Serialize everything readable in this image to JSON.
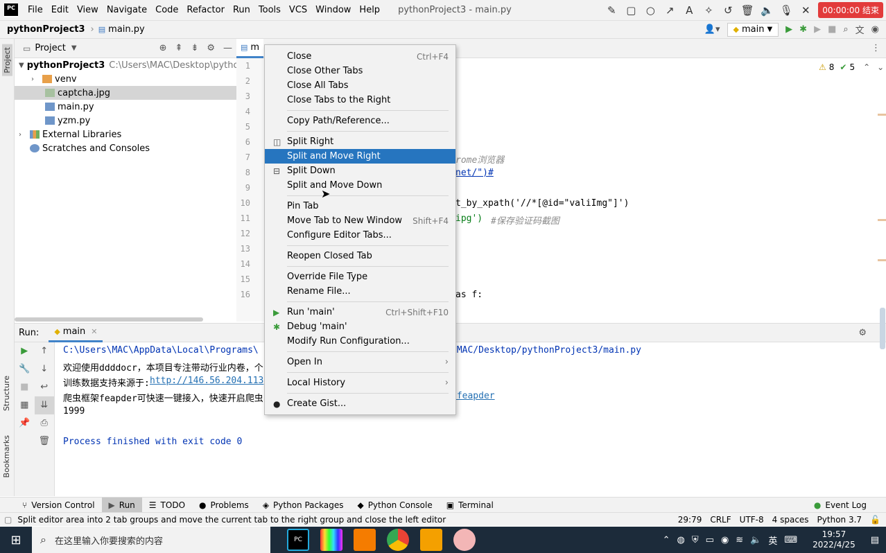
{
  "menubar": {
    "logo": "PC",
    "items": [
      "File",
      "Edit",
      "View",
      "Navigate",
      "Code",
      "Refactor",
      "Run",
      "Tools",
      "VCS",
      "Window",
      "Help"
    ],
    "title": "pythonProject3 - main.py",
    "recorder": "00:00:00 结束"
  },
  "navbar": {
    "project": "pythonProject3",
    "file": "main.py",
    "run_config": "main"
  },
  "project_panel": {
    "title": "Project",
    "tree": [
      {
        "label": "pythonProject3",
        "extra": "C:\\Users\\MAC\\Desktop\\pytho"
      },
      {
        "label": "venv"
      },
      {
        "label": "captcha.jpg"
      },
      {
        "label": "main.py"
      },
      {
        "label": "yzm.py"
      },
      {
        "label": "External Libraries"
      },
      {
        "label": "Scratches and Consoles"
      }
    ]
  },
  "editor": {
    "tab": "m",
    "inspections": {
      "warnings": "8",
      "ok": "5"
    },
    "line_numbers": [
      "1",
      "2",
      "3",
      "4",
      "5",
      "6",
      "7",
      "8",
      "9",
      "10",
      "11",
      "12",
      "13",
      "14",
      "15",
      "16"
    ],
    "code": {
      "l7": "rome浏览器",
      "l8": "net/\")#",
      "l10": "t_by_xpath('//*[@id=\"valiImg\"]')",
      "l11a": "ipg')  ",
      "l11b": "#保存验证码截图",
      "l16": "as f:"
    }
  },
  "run_panel": {
    "label": "Run:",
    "tab": "main",
    "lines": {
      "l1a": "C:\\Users\\MAC\\AppData\\Local\\Programs\\",
      "l1b": "/MAC/Desktop/pythonProject3/main.py",
      "l2": "欢迎使用ddddocr，本项目专注带动行业内卷，个",
      "l3a": "训练数据支持来源于:",
      "l3b": "http://146.56.204.113",
      "l4a": "爬虫框架feapder可快速一键接入，快速开启爬虫",
      "l4b": "/feapder",
      "l5": "1999",
      "l6": "Process finished with exit code 0"
    }
  },
  "left_strip": {
    "project": "Project",
    "structure": "Structure",
    "bookmarks": "Bookmarks"
  },
  "toolwindows": [
    "Version Control",
    "Run",
    "TODO",
    "Problems",
    "Python Packages",
    "Python Console",
    "Terminal"
  ],
  "event_log": "Event Log",
  "status": {
    "message": "Split editor area into 2 tab groups and move the current tab to the right group and close the left editor",
    "position": "29:79",
    "line_sep": "CRLF",
    "encoding": "UTF-8",
    "indent": "4 spaces",
    "interpreter": "Python 3.7"
  },
  "context_menu": {
    "items": [
      {
        "label": "Close",
        "shortcut": "Ctrl+F4"
      },
      {
        "label": "Close Other Tabs"
      },
      {
        "label": "Close All Tabs"
      },
      {
        "label": "Close Tabs to the Right"
      },
      {
        "label": "Copy Path/Reference..."
      },
      {
        "label": "Split Right"
      },
      {
        "label": "Split and Move Right"
      },
      {
        "label": "Split Down"
      },
      {
        "label": "Split and Move Down"
      },
      {
        "label": "Pin Tab"
      },
      {
        "label": "Move Tab to New Window",
        "shortcut": "Shift+F4"
      },
      {
        "label": "Configure Editor Tabs..."
      },
      {
        "label": "Reopen Closed Tab"
      },
      {
        "label": "Override File Type"
      },
      {
        "label": "Rename File..."
      },
      {
        "label": "Run 'main'",
        "shortcut": "Ctrl+Shift+F10"
      },
      {
        "label": "Debug 'main'"
      },
      {
        "label": "Modify Run Configuration..."
      },
      {
        "label": "Open In"
      },
      {
        "label": "Local History"
      },
      {
        "label": "Create Gist..."
      }
    ]
  },
  "taskbar": {
    "search_placeholder": "在这里输入你要搜索的内容",
    "ime": "英",
    "time": "19:57",
    "date": "2022/4/25"
  },
  "colors": {
    "accent": "#2675bf",
    "code_blue": "#0033b3",
    "link": "#2470b3",
    "comment": "#8c8c8c"
  }
}
